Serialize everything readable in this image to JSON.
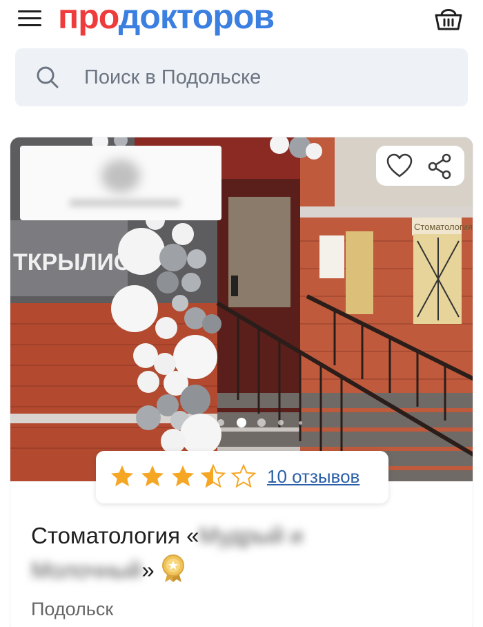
{
  "header": {
    "logo_part1": "про",
    "logo_part2": "докторов",
    "menu_icon": "hamburger-menu-icon",
    "basket_icon": "basket-icon"
  },
  "search": {
    "placeholder": "Поиск в Подольске",
    "icon": "search-icon"
  },
  "card": {
    "photo_sign_text": "ТКРЫЛИСЬ",
    "photo_sign_right": "Стоматология",
    "favorite_icon": "heart-icon",
    "share_icon": "share-icon",
    "carousel": {
      "count": 5,
      "active": 1
    },
    "rating": {
      "value": 3.5,
      "max": 5
    },
    "reviews_label": "10 отзывов",
    "title_prefix": "Стоматология «",
    "title_blurred_1": "Мудрый и",
    "title_blurred_2": "Молочный",
    "title_suffix": "»",
    "badge_icon": "medal-icon",
    "city": "Подольск"
  },
  "colors": {
    "logo_red": "#ee3b3b",
    "logo_blue": "#3b7fe0",
    "star": "#f5a623",
    "link": "#2b5fa8",
    "search_bg": "#eef2f7"
  }
}
